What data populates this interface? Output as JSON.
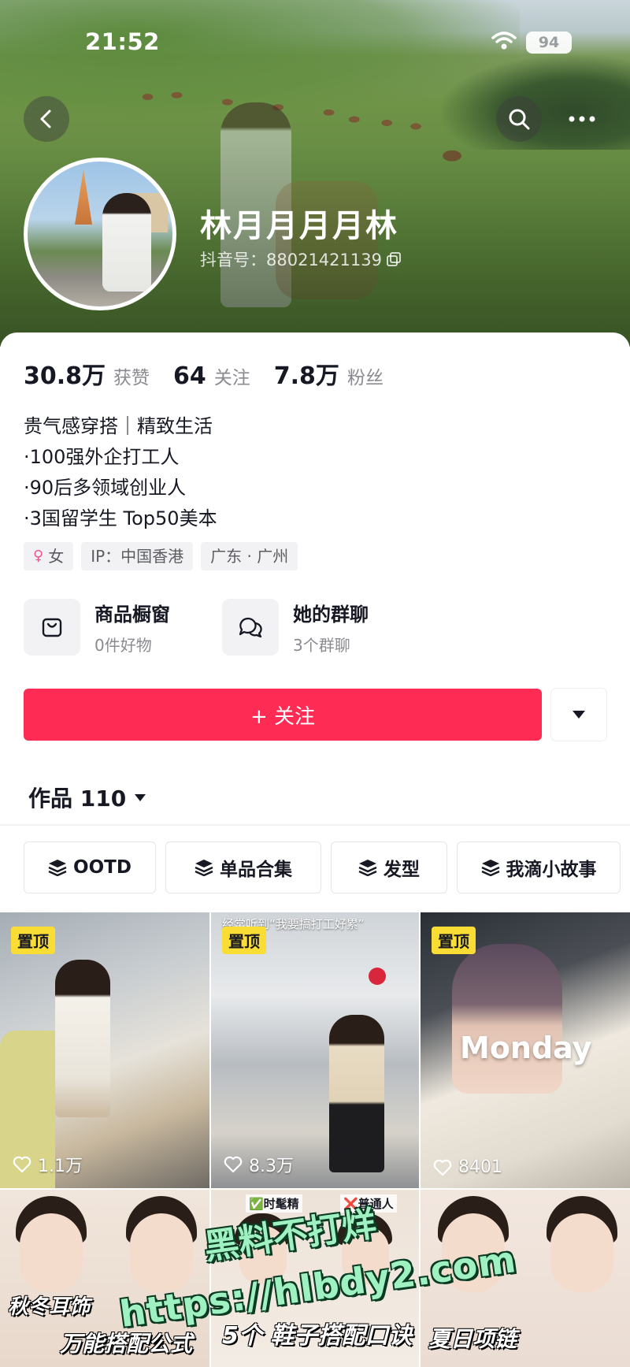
{
  "status_bar": {
    "time": "21:52",
    "battery": "94"
  },
  "header": {
    "back_icon": "chevron-left-icon",
    "search_icon": "search-icon",
    "more_icon": "more-horizontal-icon"
  },
  "profile": {
    "nickname": "林月月月月林",
    "douyin_id": "抖音号：88021421139",
    "copy_icon": "copy-icon"
  },
  "stats": [
    {
      "value": "30.8万",
      "label": "获赞"
    },
    {
      "value": "64",
      "label": "关注"
    },
    {
      "value": "7.8万",
      "label": "粉丝"
    }
  ],
  "bio": [
    "贵气感穿搭｜精致生活",
    "·100强外企打工人",
    "·90后多领域创业人",
    "·3国留学生 Top50美本"
  ],
  "tags": {
    "gender": "女",
    "ip": "IP：中国香港",
    "location": "广东 · 广州"
  },
  "entries": [
    {
      "title": "商品橱窗",
      "subtitle": "0件好物",
      "icon": "shopping-bag-icon"
    },
    {
      "title": "她的群聊",
      "subtitle": "3个群聊",
      "icon": "group-chat-icon"
    }
  ],
  "follow_button": {
    "label": "+ 关注",
    "color": "#fe2c55"
  },
  "works_tab": {
    "label": "作品 110"
  },
  "collections": [
    {
      "label": "OOTD"
    },
    {
      "label": "单品合集"
    },
    {
      "label": "发型"
    },
    {
      "label": "我滴小故事"
    }
  ],
  "videos": [
    {
      "pinned": "置顶",
      "likes": "1.1万"
    },
    {
      "pinned": "置顶",
      "likes": "8.3万",
      "caption": "经常听到“我要搞打工好累”"
    },
    {
      "pinned": "置顶",
      "likes": "8401",
      "overlay": "Monday"
    },
    {
      "cover_text": "秋冬耳饰",
      "cover_text2": "万能搭配公式"
    },
    {
      "label_left": "✅时髦精",
      "label_right": "❌普通人",
      "cover_text": "5个 鞋子搭配口诀"
    },
    {
      "cover_text": "夏日项链"
    }
  ],
  "watermark": {
    "line1": "黑料不打烊",
    "line2": "https://hlbdy2.com"
  },
  "colors": {
    "accent": "#fe2c55",
    "pin": "#fadd34"
  }
}
